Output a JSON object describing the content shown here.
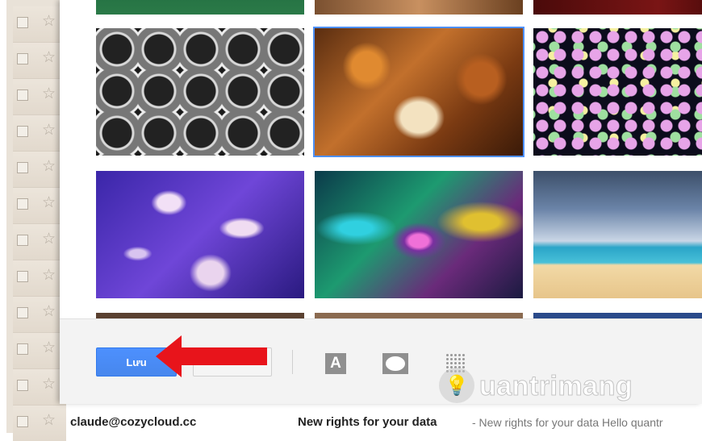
{
  "dialog": {
    "save_label": "Lưu",
    "cancel_label": ""
  },
  "watermark": {
    "text": "uantrimang",
    "icon": "lightbulb-icon"
  },
  "email_row": {
    "sender": "claude@cozycloud.cc",
    "subject": "New rights for your data",
    "snippet": " - New rights for your data Hello quantr"
  },
  "colors": {
    "save_button": "#4d90fe",
    "arrow": "#e8141b",
    "selection_outline": "#4d90fe"
  },
  "themes": [
    {
      "name": "green-landscape",
      "selected": false
    },
    {
      "name": "autumn-top",
      "selected": false
    },
    {
      "name": "red-top",
      "selected": false
    },
    {
      "name": "steel-pipes",
      "selected": false
    },
    {
      "name": "autumn-leaves",
      "selected": true
    },
    {
      "name": "bokeh-lights",
      "selected": false
    },
    {
      "name": "jellyfish",
      "selected": false
    },
    {
      "name": "water-drop",
      "selected": false
    },
    {
      "name": "beach",
      "selected": false
    }
  ]
}
